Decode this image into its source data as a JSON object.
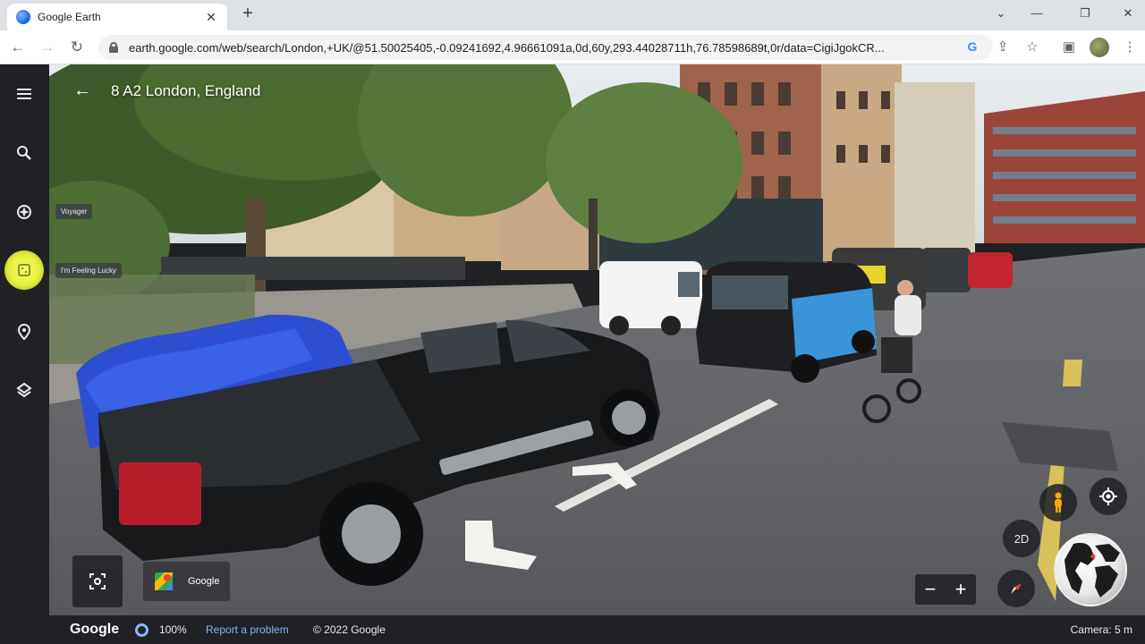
{
  "browser": {
    "tab_title": "Google Earth",
    "url": "earth.google.com/web/search/London,+UK/@51.50025405,-0.09241692,4.96661091a,0d,60y,293.44028711h,76.78598689t,0r/data=CigiJgokCR...",
    "icons": [
      "globe-favicon",
      "close-icon",
      "plus-icon",
      "back-arrow-icon",
      "forward-arrow-icon",
      "reload-icon",
      "lock-icon",
      "google-g-icon",
      "share-icon",
      "star-icon",
      "sidepanel-icon",
      "profile-avatar",
      "more-icon"
    ]
  },
  "earth": {
    "place_title": "8 A2 London, England",
    "tooltips": {
      "voyager": "Voyager",
      "lucky": "I'm Feeling Lucky"
    },
    "attribution": "Google",
    "btn_2d": "2D",
    "zoom_minus": "−",
    "zoom_plus": "+"
  },
  "status": {
    "logo": "Google",
    "percent": "100%",
    "report": "Report a problem",
    "copyright": "© 2022 Google",
    "camera": "Camera: 5 m"
  },
  "colors": {
    "sidebar": "#202124",
    "accent": "#8ab4f8",
    "highlight": "#e6f03a"
  }
}
